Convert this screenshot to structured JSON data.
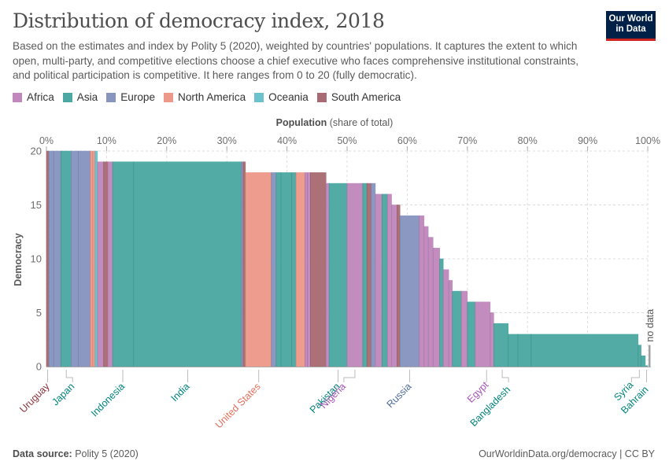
{
  "header": {
    "title": "Distribution of democracy index, 2018",
    "subtitle": "Based on the estimates and index by Polity 5 (2020), weighted by countries' populations. It captures the extent to which open, multi-party, and competitive elections choose a chief executive who faces comprehensive institutional constraints, and political participation is competitive. It here ranges from 0 to 20 (fully democratic).",
    "logo_line1": "Our World",
    "logo_line2": "in Data"
  },
  "footer": {
    "source_label": "Data source:",
    "source_value": "Polity 5 (2020)",
    "url": "OurWorldinData.org/democracy | CC BY"
  },
  "colors": {
    "Africa": "#c088bd",
    "Asia": "#4ca8a2",
    "Europe": "#8795bf",
    "North America": "#ec998a",
    "Oceania": "#6ac3cc",
    "South America": "#a96b73",
    "no_data": "#a0a0a0"
  },
  "label_colors": {
    "Africa": "#a652ba",
    "Asia": "#00847e",
    "Europe": "#4c6a9c",
    "North America": "#e56e5a",
    "South America": "#883039"
  },
  "chart_data": {
    "type": "area",
    "title": "Distribution of democracy index, 2018",
    "xlabel_bold": "Population",
    "xlabel_rest": "(share of total)",
    "ylabel": "Democracy",
    "xlim": [
      0,
      100
    ],
    "ylim": [
      0,
      20
    ],
    "x_ticks": [
      "0%",
      "10%",
      "20%",
      "30%",
      "40%",
      "50%",
      "60%",
      "70%",
      "80%",
      "90%",
      "100%"
    ],
    "x_tick_values": [
      0,
      10,
      20,
      30,
      40,
      50,
      60,
      70,
      80,
      90,
      100
    ],
    "y_ticks": [
      "0",
      "5",
      "10",
      "15",
      "20"
    ],
    "y_tick_values": [
      0,
      5,
      10,
      15,
      20
    ],
    "grid": true,
    "legend": {
      "position": "top-left",
      "entries": [
        "Africa",
        "Asia",
        "Europe",
        "North America",
        "Oceania",
        "South America"
      ]
    },
    "no_data_label": "no data",
    "segments": [
      {
        "start": 0.0,
        "end": 0.4,
        "value": 20,
        "region": "South America"
      },
      {
        "start": 0.4,
        "end": 1.2,
        "value": 20,
        "region": "Europe"
      },
      {
        "start": 1.2,
        "end": 2.4,
        "value": 20,
        "region": "Europe"
      },
      {
        "start": 2.4,
        "end": 4.1,
        "value": 20,
        "region": "Asia"
      },
      {
        "start": 4.1,
        "end": 5.3,
        "value": 20,
        "region": "Europe"
      },
      {
        "start": 5.3,
        "end": 7.3,
        "value": 20,
        "region": "Europe"
      },
      {
        "start": 7.3,
        "end": 7.7,
        "value": 20,
        "region": "North America"
      },
      {
        "start": 7.7,
        "end": 8.1,
        "value": 20,
        "region": "North America"
      },
      {
        "start": 8.1,
        "end": 8.5,
        "value": 20,
        "region": "Oceania"
      },
      {
        "start": 8.5,
        "end": 9.5,
        "value": 19,
        "region": "Africa"
      },
      {
        "start": 9.5,
        "end": 10.2,
        "value": 19,
        "region": "South America"
      },
      {
        "start": 10.2,
        "end": 11.0,
        "value": 19,
        "region": "Africa"
      },
      {
        "start": 11.0,
        "end": 14.5,
        "value": 19,
        "region": "Asia"
      },
      {
        "start": 14.5,
        "end": 32.4,
        "value": 19,
        "region": "Asia"
      },
      {
        "start": 32.4,
        "end": 32.7,
        "value": 19,
        "region": "Europe"
      },
      {
        "start": 32.7,
        "end": 33.1,
        "value": 19,
        "region": "South America"
      },
      {
        "start": 33.1,
        "end": 37.4,
        "value": 18,
        "region": "North America"
      },
      {
        "start": 37.4,
        "end": 38.2,
        "value": 18,
        "region": "Europe"
      },
      {
        "start": 38.2,
        "end": 39.0,
        "value": 18,
        "region": "Asia"
      },
      {
        "start": 39.0,
        "end": 40.8,
        "value": 18,
        "region": "Asia"
      },
      {
        "start": 40.8,
        "end": 41.5,
        "value": 18,
        "region": "Asia"
      },
      {
        "start": 41.5,
        "end": 43.0,
        "value": 18,
        "region": "North America"
      },
      {
        "start": 43.0,
        "end": 43.4,
        "value": 18,
        "region": "Africa"
      },
      {
        "start": 43.4,
        "end": 43.9,
        "value": 18,
        "region": "Africa"
      },
      {
        "start": 43.9,
        "end": 46.5,
        "value": 18,
        "region": "South America"
      },
      {
        "start": 46.5,
        "end": 47.0,
        "value": 17,
        "region": "Africa"
      },
      {
        "start": 47.0,
        "end": 50.0,
        "value": 17,
        "region": "Asia"
      },
      {
        "start": 50.0,
        "end": 52.6,
        "value": 17,
        "region": "Africa"
      },
      {
        "start": 52.6,
        "end": 53.3,
        "value": 17,
        "region": "Asia"
      },
      {
        "start": 53.3,
        "end": 54.0,
        "value": 17,
        "region": "South America"
      },
      {
        "start": 54.0,
        "end": 54.7,
        "value": 17,
        "region": "Europe"
      },
      {
        "start": 54.7,
        "end": 55.8,
        "value": 16,
        "region": "Africa"
      },
      {
        "start": 55.8,
        "end": 56.7,
        "value": 16,
        "region": "Asia"
      },
      {
        "start": 56.7,
        "end": 57.4,
        "value": 16,
        "region": "Africa"
      },
      {
        "start": 57.4,
        "end": 58.3,
        "value": 15,
        "region": "Africa"
      },
      {
        "start": 58.3,
        "end": 58.8,
        "value": 15,
        "region": "South America"
      },
      {
        "start": 58.8,
        "end": 62.0,
        "value": 14,
        "region": "Europe"
      },
      {
        "start": 62.0,
        "end": 62.8,
        "value": 14,
        "region": "Africa"
      },
      {
        "start": 62.8,
        "end": 63.5,
        "value": 13,
        "region": "Africa"
      },
      {
        "start": 63.5,
        "end": 64.3,
        "value": 12,
        "region": "Africa"
      },
      {
        "start": 64.3,
        "end": 65.4,
        "value": 11,
        "region": "Africa"
      },
      {
        "start": 65.4,
        "end": 66.0,
        "value": 10,
        "region": "Asia"
      },
      {
        "start": 66.0,
        "end": 66.9,
        "value": 9,
        "region": "Africa"
      },
      {
        "start": 66.9,
        "end": 67.5,
        "value": 8,
        "region": "Africa"
      },
      {
        "start": 67.5,
        "end": 69.0,
        "value": 7,
        "region": "Asia"
      },
      {
        "start": 69.0,
        "end": 70.0,
        "value": 7,
        "region": "Africa"
      },
      {
        "start": 70.0,
        "end": 71.3,
        "value": 6,
        "region": "Asia"
      },
      {
        "start": 71.3,
        "end": 73.8,
        "value": 6,
        "region": "Africa"
      },
      {
        "start": 73.8,
        "end": 74.4,
        "value": 5,
        "region": "Africa"
      },
      {
        "start": 74.4,
        "end": 76.8,
        "value": 4,
        "region": "Asia"
      },
      {
        "start": 76.8,
        "end": 78.4,
        "value": 3,
        "region": "Asia"
      },
      {
        "start": 78.4,
        "end": 80.6,
        "value": 3,
        "region": "Asia"
      },
      {
        "start": 80.6,
        "end": 98.4,
        "value": 3,
        "region": "Asia"
      },
      {
        "start": 98.4,
        "end": 98.9,
        "value": 2,
        "region": "Asia"
      },
      {
        "start": 98.9,
        "end": 99.6,
        "value": 1,
        "region": "Asia"
      },
      {
        "start": 99.6,
        "end": 100.0,
        "value": 0,
        "region": "Asia"
      }
    ],
    "no_data_segment": {
      "start": 100.0,
      "end": 100.3,
      "value": 2
    },
    "annotations": [
      {
        "label": "Uruguay",
        "x": 0.2,
        "region": "South America"
      },
      {
        "label": "Japan",
        "x": 3.3,
        "region": "Asia"
      },
      {
        "label": "Indonesia",
        "x": 12.7,
        "region": "Asia"
      },
      {
        "label": "India",
        "x": 23.5,
        "region": "Asia"
      },
      {
        "label": "United States",
        "x": 35.3,
        "region": "North America"
      },
      {
        "label": "Pakistan",
        "x": 48.5,
        "region": "Asia"
      },
      {
        "label": "Nigeria",
        "x": 51.3,
        "region": "Africa"
      },
      {
        "label": "Russia",
        "x": 60.4,
        "region": "Europe"
      },
      {
        "label": "Egypt",
        "x": 73.2,
        "region": "Africa"
      },
      {
        "label": "Bangladesh",
        "x": 75.8,
        "region": "Asia"
      },
      {
        "label": "Syria",
        "x": 98.6,
        "region": "Asia"
      },
      {
        "label": "Bahrain",
        "x": 99.8,
        "region": "Asia"
      }
    ]
  }
}
